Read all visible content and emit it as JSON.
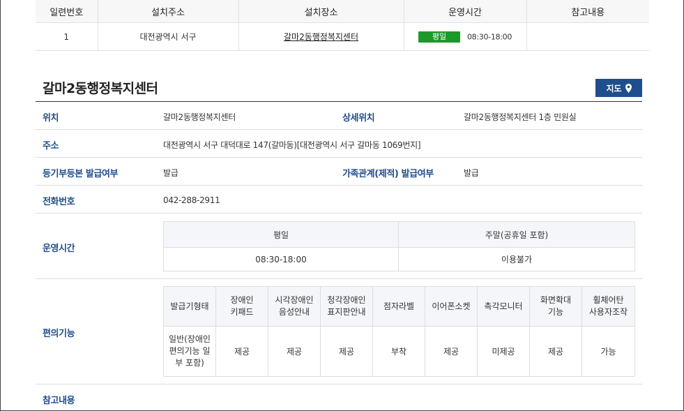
{
  "list": {
    "headers": [
      "일련번호",
      "설치주소",
      "설치장소",
      "운영시간",
      "참고내용"
    ],
    "row": {
      "serial": "1",
      "address": "대전광역시 서구",
      "place": "갈마2동행정복지센터",
      "badge": "평일",
      "hours": "08:30-18:00",
      "note": ""
    }
  },
  "detail": {
    "title": "갈마2동행정복지센터",
    "map_button": "지도",
    "location_label": "위치",
    "location_value": "갈마2동행정복지센터",
    "detail_location_label": "상세위치",
    "detail_location_value": "갈마2동행정복지센터 1층 민원실",
    "address_label": "주소",
    "address_value": "대전광역시 서구 대덕대로 147(갈마동)[대전광역시 서구 갈마동 1069번지]",
    "registry_label": "등기부등본 발급여부",
    "registry_value": "발급",
    "family_label": "가족관계(제적) 발급여부",
    "family_value": "발급",
    "phone_label": "전화번호",
    "phone_value": "042-288-2911",
    "hours_label": "운영시간",
    "hours_table": {
      "headers": [
        "평일",
        "주말(공휴일 포함)"
      ],
      "values": [
        "08:30-18:00",
        "이용불가"
      ]
    },
    "convenience_label": "편의기능",
    "convenience_table": {
      "headers": [
        "발급기형태",
        "장애인\n키패드",
        "시각장애인\n음성안내",
        "청각장애인\n표지판안내",
        "점자라벨",
        "이어폰소켓",
        "촉각모니터",
        "화면확대\n기능",
        "휠체어탄\n사용자조작"
      ],
      "values": [
        "일반(장애인\n편의기능 일\n부 포함)",
        "제공",
        "제공",
        "제공",
        "부착",
        "제공",
        "미제공",
        "제공",
        "가능"
      ]
    },
    "note_label": "참고내용"
  }
}
